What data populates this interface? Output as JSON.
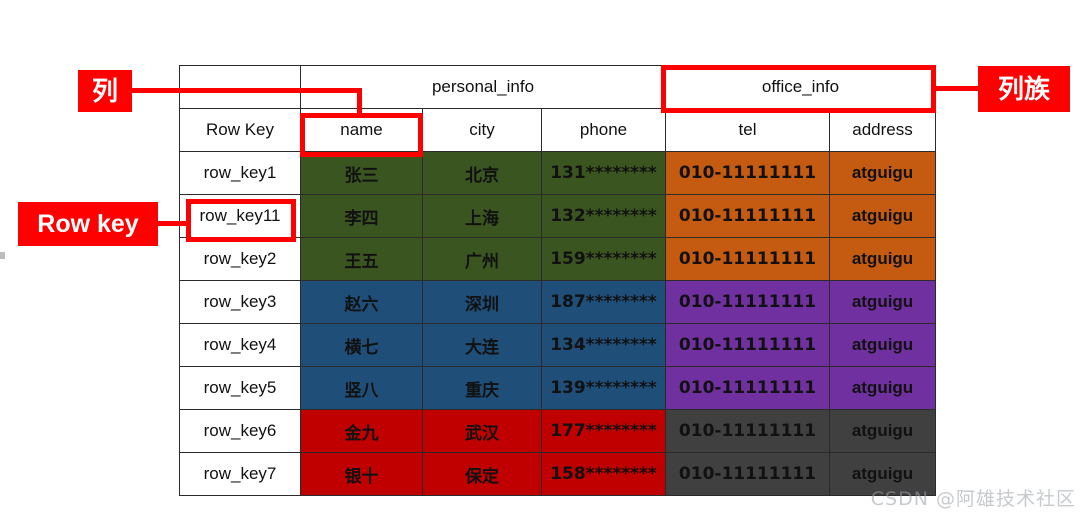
{
  "annotations": {
    "column_label": "列",
    "rowkey_label": "Row key",
    "column_family_label": "列族"
  },
  "table": {
    "corner_header": "",
    "column_families": [
      {
        "name": "personal_info",
        "span": 3
      },
      {
        "name": "office_info",
        "span": 2
      }
    ],
    "headers": [
      "Row Key",
      "name",
      "city",
      "phone",
      "tel",
      "address"
    ],
    "rows": [
      {
        "row_key": "row_key1",
        "name": "张三",
        "city": "北京",
        "phone": "131********",
        "tel": "010-11111111",
        "address": "atguigu",
        "personal_color": "#3a5520",
        "office_color": "#c55a11"
      },
      {
        "row_key": "row_key11",
        "name": "李四",
        "city": "上海",
        "phone": "132********",
        "tel": "010-11111111",
        "address": "atguigu",
        "personal_color": "#3a5520",
        "office_color": "#c55a11"
      },
      {
        "row_key": "row_key2",
        "name": "王五",
        "city": "广州",
        "phone": "159********",
        "tel": "010-11111111",
        "address": "atguigu",
        "personal_color": "#3a5520",
        "office_color": "#c55a11"
      },
      {
        "row_key": "row_key3",
        "name": "赵六",
        "city": "深圳",
        "phone": "187********",
        "tel": "010-11111111",
        "address": "atguigu",
        "personal_color": "#1f4e79",
        "office_color": "#7030a0"
      },
      {
        "row_key": "row_key4",
        "name": "横七",
        "city": "大连",
        "phone": "134********",
        "tel": "010-11111111",
        "address": "atguigu",
        "personal_color": "#1f4e79",
        "office_color": "#7030a0"
      },
      {
        "row_key": "row_key5",
        "name": "竖八",
        "city": "重庆",
        "phone": "139********",
        "tel": "010-11111111",
        "address": "atguigu",
        "personal_color": "#1f4e79",
        "office_color": "#7030a0"
      },
      {
        "row_key": "row_key6",
        "name": "金九",
        "city": "武汉",
        "phone": "177********",
        "tel": "010-11111111",
        "address": "atguigu",
        "personal_color": "#c00000",
        "office_color": "#404040"
      },
      {
        "row_key": "row_key7",
        "name": "银十",
        "city": "保定",
        "phone": "158********",
        "tel": "010-11111111",
        "address": "atguigu",
        "personal_color": "#c00000",
        "office_color": "#404040"
      }
    ]
  },
  "watermark": {
    "text": "CSDN @阿雄技术社区"
  },
  "colors": {
    "annotation_red": "#ff0000",
    "green": "#3a5520",
    "blue": "#1f4e79",
    "red": "#c00000",
    "orange": "#c55a11",
    "purple": "#7030a0",
    "gray": "#404040",
    "grid": "#2b2b2b"
  }
}
